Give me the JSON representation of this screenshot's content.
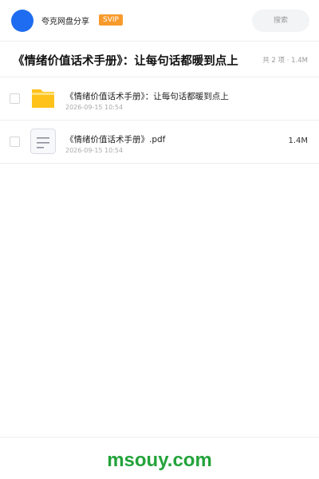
{
  "header": {
    "app_name": "夸克网盘分享",
    "badge": "SVIP",
    "search_placeholder": "搜索",
    "avatar_color": "#1e6cf0",
    "badge_color": "#f79a2c"
  },
  "folder": {
    "title": "《情绪价值话术手册》：让每句话都暖到点上",
    "summary": "共 2 项 · 1.4M"
  },
  "files": [
    {
      "name": "《情绪价值话术手册》：让每句话都暖到点上",
      "time": "2026-09-15 10:54",
      "size": "",
      "icon": "folder-icon"
    },
    {
      "name": "《情绪价值话术手册》.pdf",
      "time": "2026-09-15 10:54",
      "size": "1.4M",
      "icon": "document-icon"
    }
  ],
  "footer": {
    "watermark": "msouy.com",
    "watermark_color": "#23a33a"
  }
}
